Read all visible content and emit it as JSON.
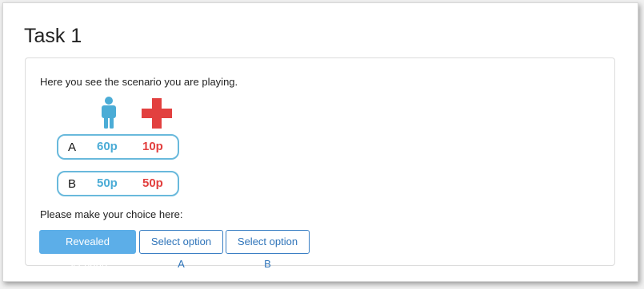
{
  "task": {
    "title": "Task 1"
  },
  "scenario": {
    "intro": "Here you see the scenario you are playing.",
    "icons": {
      "person": "person-icon",
      "cross": "red-cross-icon"
    },
    "colors": {
      "person_blue": "#4bacd6",
      "cross_red": "#e2403f",
      "box_border": "#69b9dc"
    },
    "options": [
      {
        "letter": "A",
        "blue_value": "60p",
        "red_value": "10p"
      },
      {
        "letter": "B",
        "blue_value": "50p",
        "red_value": "50p"
      }
    ]
  },
  "choice": {
    "prompt": "Please make your choice here:",
    "buttons": {
      "revealed": "Revealed scenario",
      "option_a": "Select option A",
      "option_b": "Select option B"
    },
    "colors": {
      "primary": "#5caee8",
      "outline": "#3a7fc4"
    }
  }
}
